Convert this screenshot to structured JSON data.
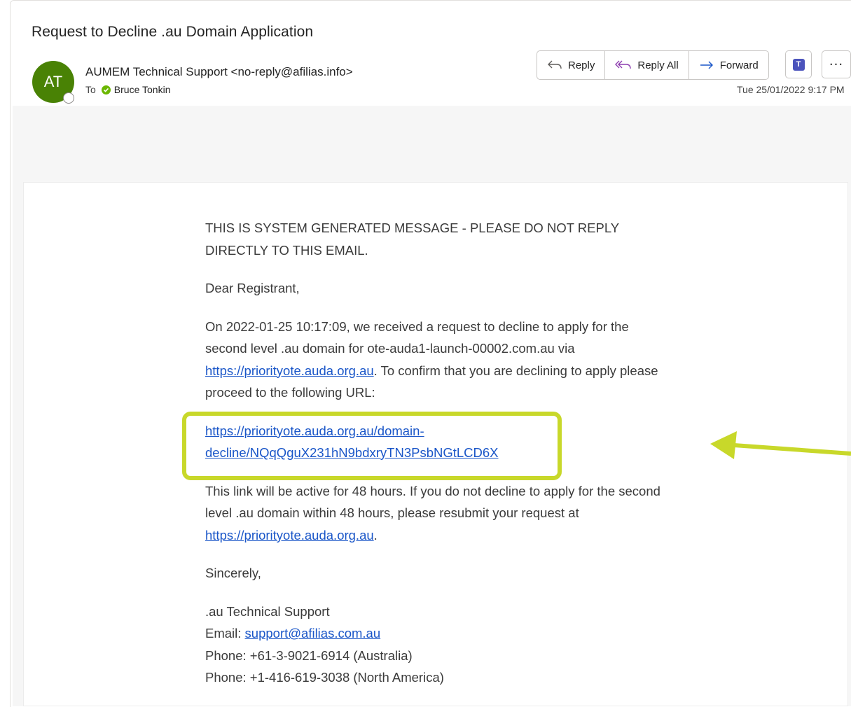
{
  "email": {
    "subject": "Request to Decline .au Domain Application",
    "avatar_initials": "AT",
    "avatar_color": "#498205",
    "sender": "AUMEM Technical Support <no-reply@afilias.info>",
    "to_label": "To",
    "recipient": "Bruce Tonkin",
    "date": "Tue 25/01/2022 9:17 PM"
  },
  "actions": {
    "reply": "Reply",
    "reply_all": "Reply All",
    "forward": "Forward",
    "teams_icon": "teams-icon",
    "more": "···"
  },
  "body": {
    "warning": "THIS IS SYSTEM GENERATED MESSAGE - PLEASE DO NOT REPLY DIRECTLY TO THIS EMAIL.",
    "greeting": "Dear Registrant,",
    "para1_before": "On 2022-01-25 10:17:09, we received a request to decline to apply for the second level .au domain for ote-auda1-launch-00002.com.au via ",
    "para1_link": "https://priorityote.auda.org.au",
    "para1_after": ". To confirm that you are declining to apply please proceed to the following URL:",
    "decline_link_line1": "https://priorityote.auda.org.au/domain-",
    "decline_link_line2": "decline/NQqQguX231hN9bdxryTN3PsbNGtLCD6X",
    "para2_before": "This link will be active for 48 hours. If you do not decline to apply for the second level .au domain within 48 hours, please resubmit your request at ",
    "para2_link": "https://priorityote.auda.org.au",
    "para2_after": ".",
    "closing": "Sincerely,",
    "sig_name": ".au Technical Support",
    "sig_email_label": "Email: ",
    "sig_email": "support@afilias.com.au",
    "sig_phone1": "Phone: +61-3-9021-6914 (Australia)",
    "sig_phone2": "Phone: +1-416-619-3038 (North America)"
  },
  "annotation": {
    "color": "#c8d82a"
  }
}
